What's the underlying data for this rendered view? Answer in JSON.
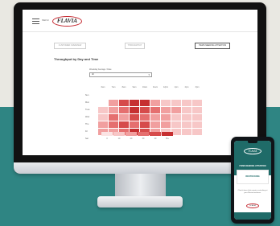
{
  "app": {
    "menu_label": "MENU",
    "logo": "FLAVIA",
    "tabs": [
      {
        "label": "CUSTOMER OVERVIEW"
      },
      {
        "label": "THROUGHPUT"
      },
      {
        "label": "ITEMS NEEDING ATTENTION"
      }
    ],
    "title": "Throughput by Day and Time",
    "filter_label": "Weekday Average / Date",
    "filter_value": "All"
  },
  "chart_data": {
    "type": "heatmap",
    "title": "Throughput by Day and Time",
    "x": [
      "6am",
      "7am",
      "8am",
      "9am",
      "10am",
      "11am",
      "12pm",
      "1pm",
      "2pm",
      "3pm"
    ],
    "y": [
      "Sun",
      "Mon",
      "Tues",
      "Wed",
      "Thu",
      "Fri",
      "Sat"
    ],
    "values": [
      [
        0,
        0,
        0,
        0,
        0,
        0,
        0,
        0,
        0,
        0
      ],
      [
        0,
        2,
        4,
        5,
        5,
        2,
        1,
        1,
        1,
        1
      ],
      [
        1,
        2,
        3,
        5,
        4,
        3,
        2,
        2,
        1,
        1
      ],
      [
        1,
        3,
        2,
        4,
        3,
        2,
        2,
        1,
        1,
        1
      ],
      [
        2,
        3,
        4,
        3,
        4,
        2,
        2,
        1,
        1,
        1
      ],
      [
        2,
        2,
        3,
        5,
        4,
        2,
        1,
        1,
        1,
        1
      ],
      [
        0,
        0,
        0,
        0,
        0,
        0,
        0,
        0,
        0,
        0
      ]
    ],
    "legend": {
      "levels": [
        0,
        1,
        2,
        3,
        4,
        5
      ],
      "labels": [
        "0",
        "10",
        "20",
        "30",
        "40",
        "50+"
      ]
    },
    "colors": [
      "#fbe4e4",
      "#f7c7c7",
      "#f19f9f",
      "#e56f6f",
      "#d64b4b",
      "#c62f31"
    ]
  },
  "phone": {
    "logo": "FLAVIA",
    "heading": "ITEMS NEEDING ATTENTION",
    "panel": "RESTOCKING",
    "body": "Check items that require restocking at your Flavia machines.",
    "brand": "FLAVIA"
  },
  "colors": {
    "teal": "#2f8583",
    "brand_red": "#c4262e"
  }
}
